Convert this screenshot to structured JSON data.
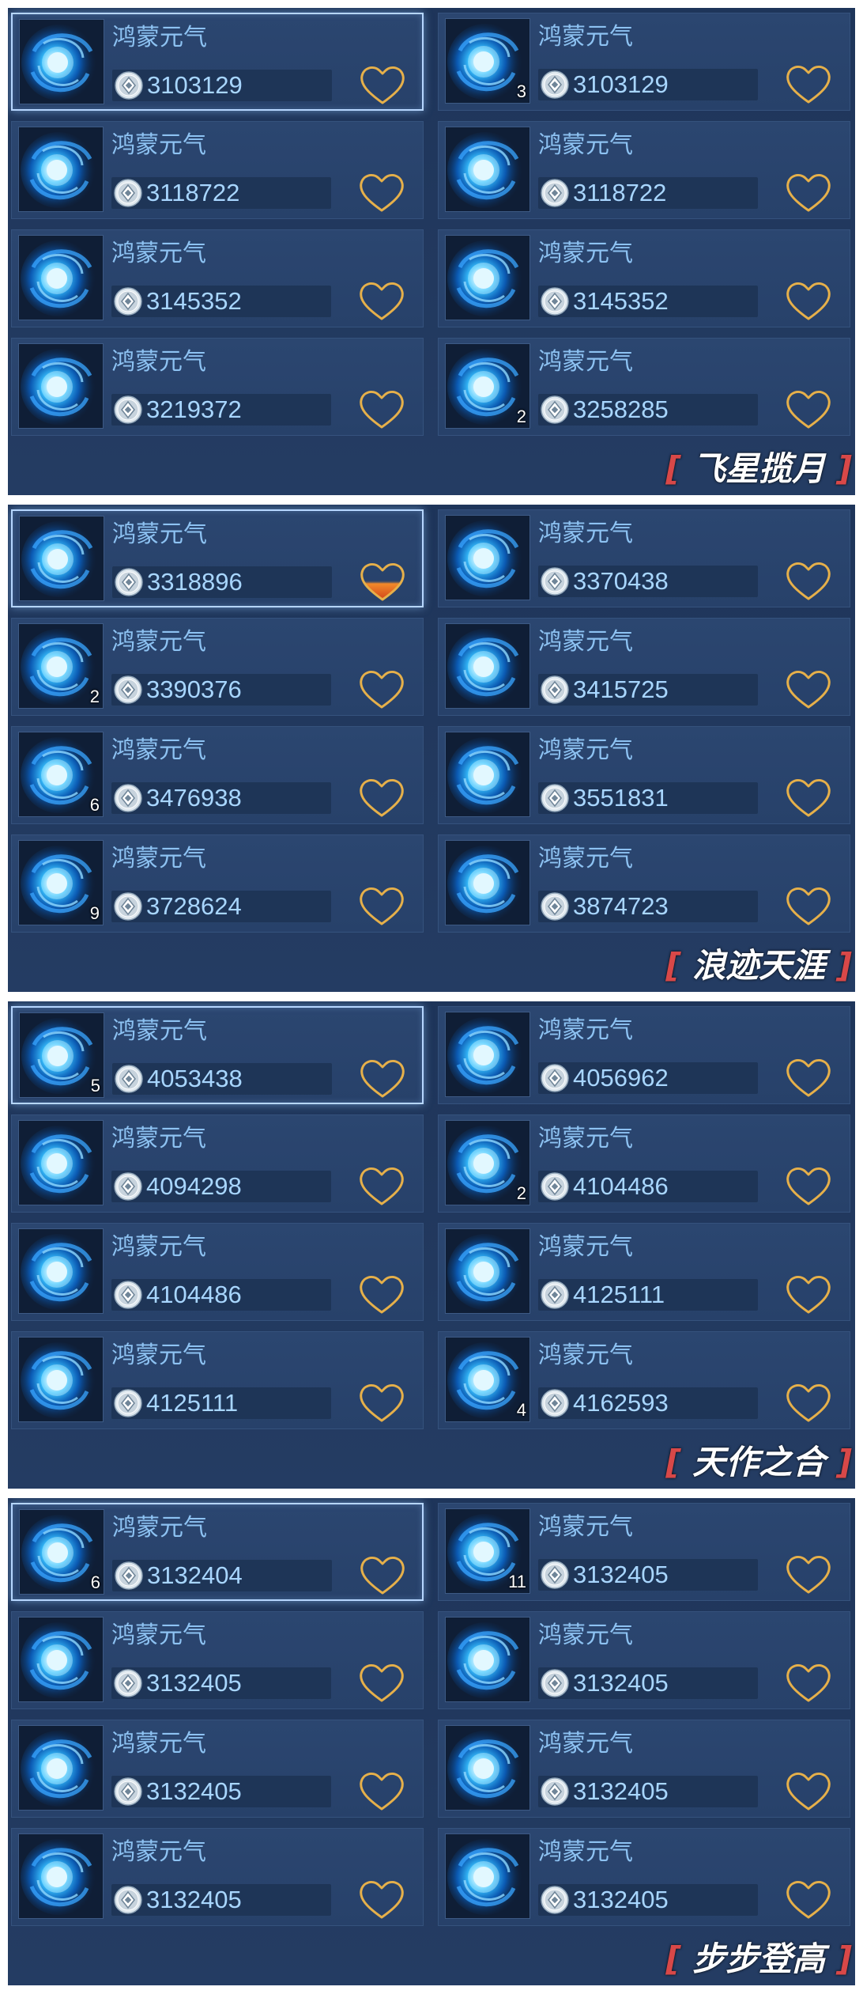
{
  "item_name": "鸿蒙元气",
  "colors": {
    "panel": "#22395f",
    "card": "#2a4570",
    "name_text": "#8dc2f2",
    "price_text": "#a8d6ff",
    "heart": "#e6b04a",
    "heart_active_fill": "#e2641a",
    "bracket": "#d84848",
    "title_text": "#ffffff"
  },
  "icons": {
    "item": "swirl-orb-icon",
    "currency": "silver-coin-icon",
    "favorite": "heart-icon"
  },
  "sections": [
    {
      "title": "飞星揽月",
      "bracket_open": "[",
      "bracket_close": "]",
      "items": [
        {
          "price": "3103129",
          "count": "",
          "selected": true,
          "favorited": false
        },
        {
          "price": "3103129",
          "count": "3",
          "selected": false,
          "favorited": false
        },
        {
          "price": "3118722",
          "count": "",
          "selected": false,
          "favorited": false
        },
        {
          "price": "3118722",
          "count": "",
          "selected": false,
          "favorited": false
        },
        {
          "price": "3145352",
          "count": "",
          "selected": false,
          "favorited": false
        },
        {
          "price": "3145352",
          "count": "",
          "selected": false,
          "favorited": false
        },
        {
          "price": "3219372",
          "count": "",
          "selected": false,
          "favorited": false
        },
        {
          "price": "3258285",
          "count": "2",
          "selected": false,
          "favorited": false
        }
      ]
    },
    {
      "title": "浪迹天涯",
      "bracket_open": "[",
      "bracket_close": "]",
      "items": [
        {
          "price": "3318896",
          "count": "",
          "selected": true,
          "favorited": true
        },
        {
          "price": "3370438",
          "count": "",
          "selected": false,
          "favorited": false
        },
        {
          "price": "3390376",
          "count": "2",
          "selected": false,
          "favorited": false
        },
        {
          "price": "3415725",
          "count": "",
          "selected": false,
          "favorited": false
        },
        {
          "price": "3476938",
          "count": "6",
          "selected": false,
          "favorited": false
        },
        {
          "price": "3551831",
          "count": "",
          "selected": false,
          "favorited": false
        },
        {
          "price": "3728624",
          "count": "9",
          "selected": false,
          "favorited": false
        },
        {
          "price": "3874723",
          "count": "",
          "selected": false,
          "favorited": false
        }
      ]
    },
    {
      "title": "天作之合",
      "bracket_open": "[",
      "bracket_close": "]",
      "items": [
        {
          "price": "4053438",
          "count": "5",
          "selected": true,
          "favorited": false
        },
        {
          "price": "4056962",
          "count": "",
          "selected": false,
          "favorited": false
        },
        {
          "price": "4094298",
          "count": "",
          "selected": false,
          "favorited": false
        },
        {
          "price": "4104486",
          "count": "2",
          "selected": false,
          "favorited": false
        },
        {
          "price": "4104486",
          "count": "",
          "selected": false,
          "favorited": false
        },
        {
          "price": "4125111",
          "count": "",
          "selected": false,
          "favorited": false
        },
        {
          "price": "4125111",
          "count": "",
          "selected": false,
          "favorited": false
        },
        {
          "price": "4162593",
          "count": "4",
          "selected": false,
          "favorited": false
        }
      ]
    },
    {
      "title": "步步登高",
      "bracket_open": "[",
      "bracket_close": "]",
      "items": [
        {
          "price": "3132404",
          "count": "6",
          "selected": true,
          "favorited": false
        },
        {
          "price": "3132405",
          "count": "11",
          "selected": false,
          "favorited": false
        },
        {
          "price": "3132405",
          "count": "",
          "selected": false,
          "favorited": false
        },
        {
          "price": "3132405",
          "count": "",
          "selected": false,
          "favorited": false
        },
        {
          "price": "3132405",
          "count": "",
          "selected": false,
          "favorited": false
        },
        {
          "price": "3132405",
          "count": "",
          "selected": false,
          "favorited": false
        },
        {
          "price": "3132405",
          "count": "",
          "selected": false,
          "favorited": false
        },
        {
          "price": "3132405",
          "count": "",
          "selected": false,
          "favorited": false
        }
      ]
    }
  ]
}
